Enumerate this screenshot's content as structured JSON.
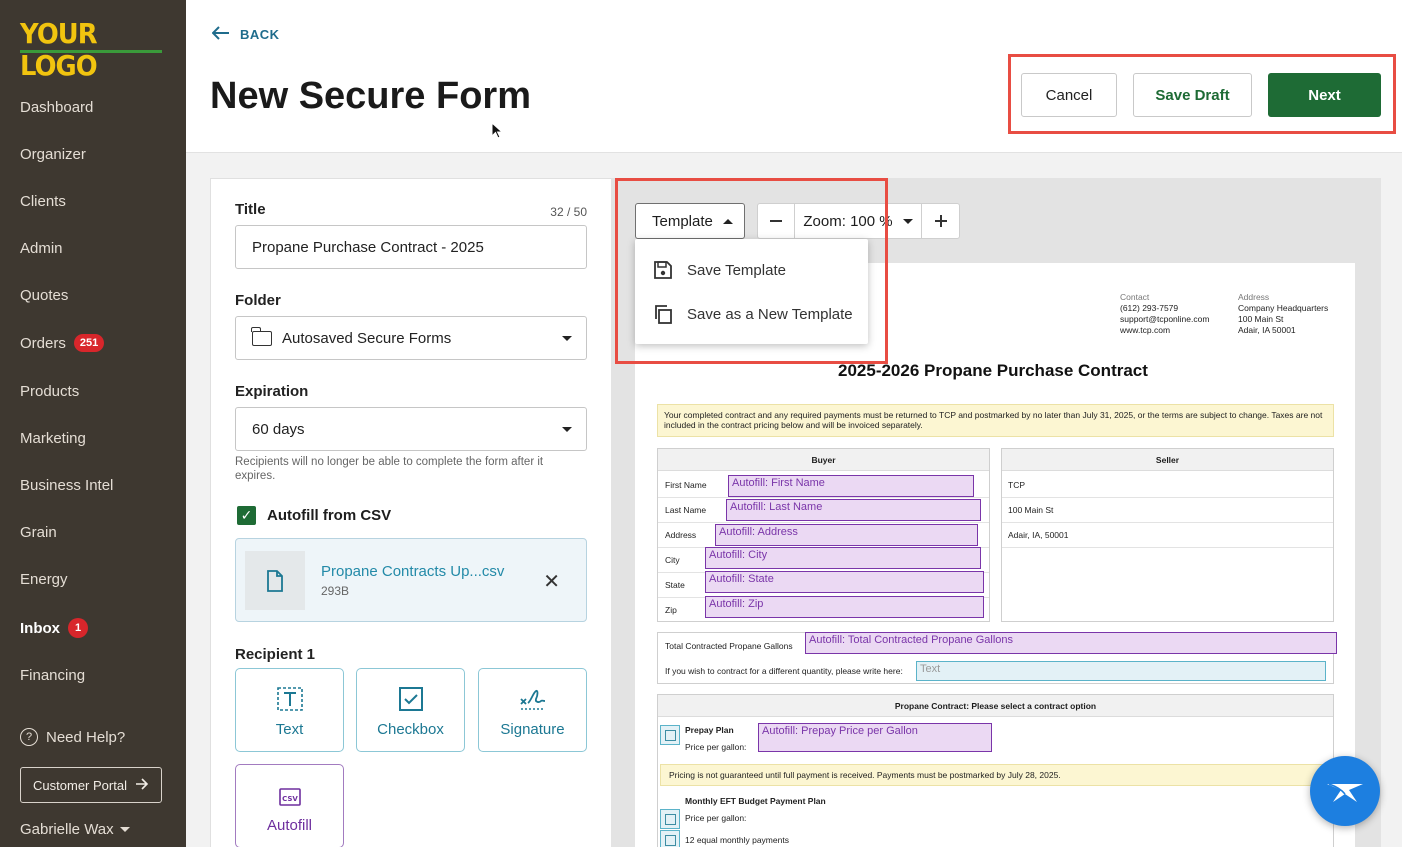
{
  "sidebar": {
    "logo": "YOUR LOGO",
    "items": [
      {
        "label": "Dashboard"
      },
      {
        "label": "Organizer"
      },
      {
        "label": "Clients"
      },
      {
        "label": "Admin"
      },
      {
        "label": "Quotes"
      },
      {
        "label": "Orders",
        "badge": "251"
      },
      {
        "label": "Products"
      },
      {
        "label": "Marketing"
      },
      {
        "label": "Business Intel"
      },
      {
        "label": "Grain"
      },
      {
        "label": "Energy"
      },
      {
        "label": "Inbox",
        "badge": "1"
      },
      {
        "label": "Financing"
      }
    ],
    "help": "Need Help?",
    "portal_button": "Customer Portal",
    "user": "Gabrielle Wax"
  },
  "header": {
    "back": "BACK",
    "title": "New Secure Form",
    "cancel": "Cancel",
    "save_draft": "Save Draft",
    "next": "Next"
  },
  "form": {
    "title_label": "Title",
    "title_counter": "32 / 50",
    "title_value": "Propane Purchase Contract - 2025",
    "folder_label": "Folder",
    "folder_value": "Autosaved Secure Forms",
    "expiration_label": "Expiration",
    "expiration_value": "60 days",
    "expiration_hint": "Recipients will no longer be able to complete the form after it expires.",
    "autofill_label": "Autofill from CSV",
    "autofill_checked": true,
    "file_name": "Propane Contracts Up...csv",
    "file_size": "293B",
    "recipient_label": "Recipient 1",
    "tiles": {
      "text": "Text",
      "checkbox": "Checkbox",
      "signature": "Signature",
      "autofill": "Autofill"
    }
  },
  "toolbar": {
    "template": "Template",
    "zoom": "Zoom: 100 %",
    "menu": {
      "save_template": "Save Template",
      "save_new": "Save as a New Template"
    }
  },
  "document": {
    "contact_cap": "Contact",
    "contact_lines": [
      "(612) 293-7579",
      "support@tcponline.com",
      "www.tcp.com"
    ],
    "address_cap": "Address",
    "address_lines": [
      "Company Headquarters",
      "100 Main St",
      "Adair, IA 50001"
    ],
    "title": "2025-2026 Propane Purchase Contract",
    "notice": "Your completed contract and any required payments must be returned to TCP and postmarked by no later than July 31, 2025, or the terms are subject to change. Taxes are not included in the contract pricing below and will be invoiced separately.",
    "buyer_head": "Buyer",
    "seller_head": "Seller",
    "buyer_rows": [
      {
        "label": "First Name",
        "field": "Autofill: First Name"
      },
      {
        "label": "Last Name",
        "field": "Autofill: Last Name"
      },
      {
        "label": "Address",
        "field": "Autofill: Address"
      },
      {
        "label": "City",
        "field": "Autofill: City"
      },
      {
        "label": "State",
        "field": "Autofill: State"
      },
      {
        "label": "Zip",
        "field": "Autofill: Zip"
      }
    ],
    "seller_rows": [
      "TCP",
      "100 Main St",
      "Adair, IA, 50001"
    ],
    "gallons_label": "Total Contracted Propane Gallons",
    "gallons_field": "Autofill: Total Contracted Propane Gallons",
    "diff_qty_label": "If you wish to contract for a different quantity, please write here:",
    "diff_qty_field": "Text",
    "option_head": "Propane Contract: Please select a contract option",
    "prepay_title": "Prepay Plan",
    "prepay_price_label": "Price per gallon:",
    "prepay_field": "Autofill: Prepay Price per Gallon",
    "pricing_note": "Pricing is not guaranteed until full payment is received. Payments must be postmarked by July 28, 2025.",
    "eft_title": "Monthly EFT Budget Payment Plan",
    "eft_price_label": "Price per gallon:",
    "eft_payments": "12 equal monthly payments"
  },
  "colors": {
    "sidebar_bg": "#3e3830",
    "primary_green": "#1e6b35",
    "link_teal": "#1c7893",
    "autofill_purple": "#7a35a9",
    "highlight_red": "#e84d43",
    "badge_red": "#d8262b"
  }
}
